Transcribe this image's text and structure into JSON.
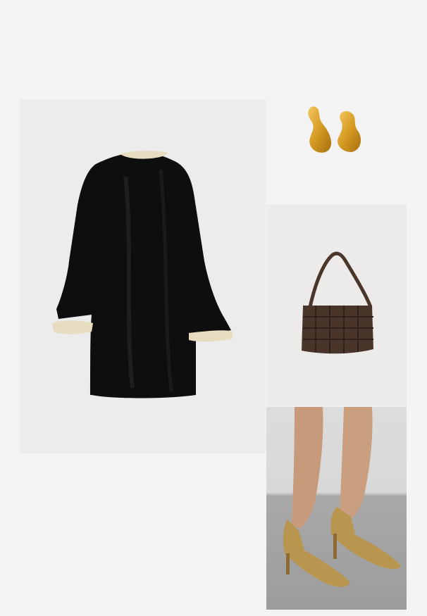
{
  "outfit": {
    "items": [
      {
        "name": "velvet-dress",
        "colors": {
          "main": "#0d0d0d",
          "trim": "#e8dcc0"
        }
      },
      {
        "name": "gold-earrings",
        "colors": {
          "main": "#d9a22a"
        }
      },
      {
        "name": "woven-shoulder-bag",
        "colors": {
          "main": "#4a352b"
        }
      },
      {
        "name": "gold-pumps",
        "colors": {
          "main": "#b99650"
        }
      }
    ]
  }
}
